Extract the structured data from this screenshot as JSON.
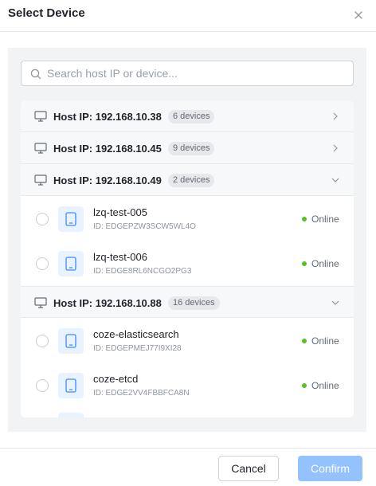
{
  "dialog": {
    "title": "Select Device",
    "close_icon": "close-icon"
  },
  "search": {
    "placeholder": "Search host IP or device...",
    "value": "",
    "icon": "search-icon"
  },
  "groups": [
    {
      "host_label": "Host IP: 192.168.10.38",
      "count_label": "6 devices",
      "expanded": false,
      "devices": []
    },
    {
      "host_label": "Host IP: 192.168.10.45",
      "count_label": "9 devices",
      "expanded": false,
      "devices": []
    },
    {
      "host_label": "Host IP: 192.168.10.49",
      "count_label": "2 devices",
      "expanded": true,
      "devices": [
        {
          "name": "lzq-test-005",
          "id": "ID: EDGEPZW3SCW5WL4O",
          "status": "Online",
          "selected": false
        },
        {
          "name": "lzq-test-006",
          "id": "ID: EDGE8RL6NCGO2PG3",
          "status": "Online",
          "selected": false
        }
      ]
    },
    {
      "host_label": "Host IP: 192.168.10.88",
      "count_label": "16 devices",
      "expanded": true,
      "devices": [
        {
          "name": "coze-elasticsearch",
          "id": "ID: EDGEPMEJ77I9XI28",
          "status": "Online",
          "selected": false
        },
        {
          "name": "coze-etcd",
          "id": "ID: EDGE2VV4FBBFCA8N",
          "status": "Online",
          "selected": false
        }
      ]
    }
  ],
  "footer": {
    "cancel_label": "Cancel",
    "confirm_label": "Confirm",
    "confirm_enabled": false
  },
  "colors": {
    "online": "#52c41a",
    "primary_disabled": "#94c2ff",
    "device_icon": "#3b8cff",
    "device_icon_bg": "#e8f3ff"
  }
}
